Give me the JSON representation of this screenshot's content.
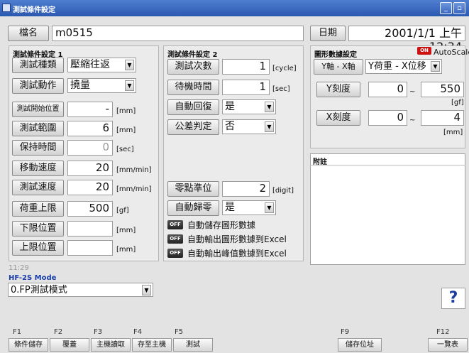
{
  "window": {
    "title": "測試條件設定",
    "minimize": "_",
    "restore": "▫"
  },
  "header": {
    "name_label": "檔名",
    "name_value": "m0515",
    "date_label": "日期",
    "date_value": "2001/1/1 上午 12:34"
  },
  "panel1": {
    "title": "測試條件設定 1",
    "test_type_label": "測試種類",
    "test_type_value": "壓縮往返",
    "test_action_label": "測試動作",
    "test_action_value": "撓量",
    "start_pos_label": "測試開始位置",
    "start_pos_value": "-",
    "start_pos_unit": "[mm]",
    "range_label": "測試範圍",
    "range_value": "6",
    "range_unit": "[mm]",
    "hold_label": "保持時間",
    "hold_value": "0",
    "hold_unit": "[sec]",
    "move_speed_label": "移動速度",
    "move_speed_value": "20",
    "move_speed_unit": "[mm/min]",
    "test_speed_label": "測試速度",
    "test_speed_value": "20",
    "test_speed_unit": "[mm/min]",
    "load_limit_label": "荷重上限",
    "load_limit_value": "500",
    "load_limit_unit": "[gf]",
    "lower_pos_label": "下限位置",
    "lower_pos_value": "",
    "lower_pos_unit": "[mm]",
    "upper_pos_label": "上限位置",
    "upper_pos_value": "",
    "upper_pos_unit": "[mm]"
  },
  "panel2": {
    "title": "測試條件設定 2",
    "count_label": "測試次數",
    "count_value": "1",
    "count_unit": "[cycle]",
    "wait_label": "待機時間",
    "wait_value": "1",
    "wait_unit": "[sec]",
    "auto_return_label": "自動回復",
    "auto_return_value": "是",
    "tolerance_label": "公差判定",
    "tolerance_value": "否",
    "zero_label": "零點準位",
    "zero_value": "2",
    "zero_unit": "[digit]",
    "auto_zero_label": "自動歸零",
    "auto_zero_value": "是",
    "off_text": "OFF",
    "opt1": "自動儲存圖形數據",
    "opt2": "自動輸出圖形數據到Excel",
    "opt3": "自動輸出峰值數據到Excel"
  },
  "panel3": {
    "title": "圖形數據設定",
    "on_text": "ON",
    "autoscale_label": "AutoScale",
    "yx_label": "Y軸 - X軸",
    "yx_value": "Y荷重 - X位移",
    "yscale_label": "Y刻度",
    "y_min": "0",
    "y_max": "550",
    "y_unit": "[gf]",
    "xscale_label": "X刻度",
    "x_min": "0",
    "x_max": "4",
    "x_unit": "[mm]",
    "tilde": "~"
  },
  "notes": {
    "title": "附註",
    "content": ""
  },
  "status": {
    "time": "11:29",
    "mode_label": "HF-2S Mode",
    "mode_value": "0.FP測試模式",
    "help": "?"
  },
  "fkeys": {
    "f1": "F1",
    "f2": "F2",
    "f3": "F3",
    "f4": "F4",
    "f5": "F5",
    "f9": "F9",
    "f12": "F12",
    "f1_label": "條件儲存",
    "f2_label": "覆蓋",
    "f3_label": "主機讀取",
    "f4_label": "存至主機",
    "f5_label": "測試",
    "f9_label": "儲存位址",
    "f12_label": "一覽表"
  },
  "colors": {
    "titlebar": "#2a59b0",
    "on_badge": "#cc1111",
    "off_badge": "#333333"
  }
}
